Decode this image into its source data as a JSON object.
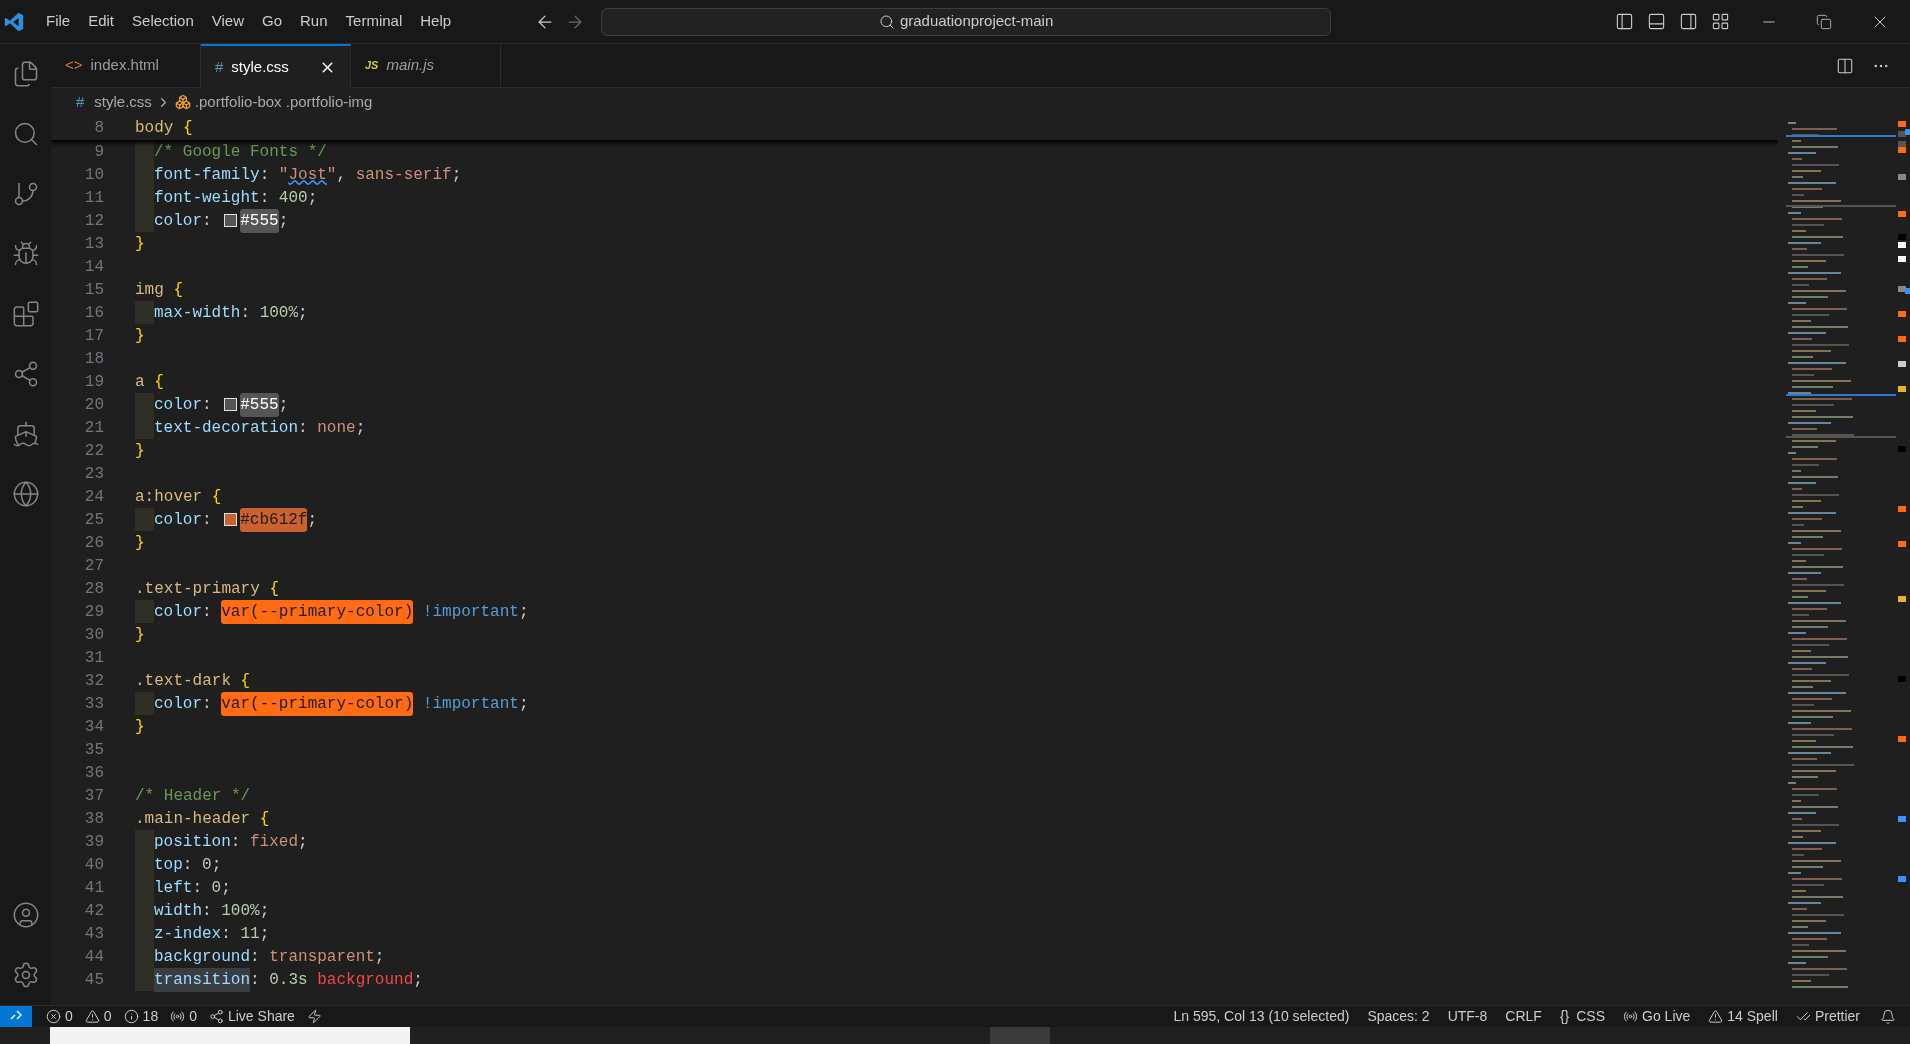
{
  "menu": [
    {
      "label": "File"
    },
    {
      "label": "Edit"
    },
    {
      "label": "Selection"
    },
    {
      "label": "View"
    },
    {
      "label": "Go"
    },
    {
      "label": "Run"
    },
    {
      "label": "Terminal"
    },
    {
      "label": "Help"
    }
  ],
  "command_center": {
    "text": "graduationproject-main"
  },
  "navigation": {
    "back_disabled": false,
    "forward_disabled": true
  },
  "tabs": [
    {
      "kind": "html",
      "icon_text": "<>",
      "label": "index.html",
      "selected": false,
      "preview": false
    },
    {
      "kind": "css",
      "icon_text": "#",
      "label": "style.css",
      "selected": true,
      "preview": false
    },
    {
      "kind": "js",
      "icon_text": "JS",
      "label": "main.js",
      "selected": false,
      "preview": true
    }
  ],
  "breadcrumb": {
    "icon_text": "#",
    "file": "style.css",
    "symbol": ".portfolio-box .portfolio-img"
  },
  "editor": {
    "sticky_line": {
      "number": "8",
      "tokens": [
        {
          "kind": "selector",
          "text": "body"
        },
        {
          "kind": "brace",
          "text": " {"
        }
      ]
    },
    "lines": [
      {
        "number": "9",
        "indented": true,
        "tokens": [
          {
            "kind": "comment",
            "text": "/* Google Fonts */"
          }
        ]
      },
      {
        "number": "10",
        "indented": true,
        "tokens": [
          {
            "kind": "property",
            "text": "font-family"
          },
          {
            "kind": "punct",
            "text": ": "
          },
          {
            "kind": "string",
            "text": "\""
          },
          {
            "kind": "misspelled",
            "text": "Jost"
          },
          {
            "kind": "string",
            "text": "\""
          },
          {
            "kind": "punct",
            "text": ", "
          },
          {
            "kind": "value",
            "text": "sans-serif"
          },
          {
            "kind": "punct",
            "text": ";"
          }
        ]
      },
      {
        "number": "11",
        "indented": true,
        "tokens": [
          {
            "kind": "property",
            "text": "font-weight"
          },
          {
            "kind": "punct",
            "text": ": "
          },
          {
            "kind": "number",
            "text": "400"
          },
          {
            "kind": "punct",
            "text": ";"
          }
        ]
      },
      {
        "number": "12",
        "indented": true,
        "tokens": [
          {
            "kind": "property",
            "text": "color"
          },
          {
            "kind": "punct",
            "text": ": "
          },
          {
            "kind": "color_literal",
            "text": "#555",
            "color": "#555555"
          },
          {
            "kind": "punct",
            "text": ";"
          }
        ]
      },
      {
        "number": "13",
        "indented": false,
        "tokens": [
          {
            "kind": "brace",
            "text": "}"
          }
        ]
      },
      {
        "number": "14",
        "indented": false
      },
      {
        "number": "15",
        "indented": false,
        "tokens": [
          {
            "kind": "selector",
            "text": "img"
          },
          {
            "kind": "brace",
            "text": " {"
          }
        ]
      },
      {
        "number": "16",
        "indented": true,
        "tokens": [
          {
            "kind": "property",
            "text": "max-width"
          },
          {
            "kind": "punct",
            "text": ": "
          },
          {
            "kind": "number",
            "text": "100%"
          },
          {
            "kind": "punct",
            "text": ";"
          }
        ]
      },
      {
        "number": "17",
        "indented": false,
        "tokens": [
          {
            "kind": "brace",
            "text": "}"
          }
        ]
      },
      {
        "number": "18",
        "indented": false
      },
      {
        "number": "19",
        "indented": false,
        "tokens": [
          {
            "kind": "selector",
            "text": "a"
          },
          {
            "kind": "brace",
            "text": " {"
          }
        ]
      },
      {
        "number": "20",
        "indented": true,
        "tokens": [
          {
            "kind": "property",
            "text": "color"
          },
          {
            "kind": "punct",
            "text": ": "
          },
          {
            "kind": "color_literal",
            "text": "#555",
            "color": "#555555"
          },
          {
            "kind": "punct",
            "text": ";"
          }
        ]
      },
      {
        "number": "21",
        "indented": true,
        "tokens": [
          {
            "kind": "property",
            "text": "text-decoration"
          },
          {
            "kind": "punct",
            "text": ": "
          },
          {
            "kind": "value",
            "text": "none"
          },
          {
            "kind": "punct",
            "text": ";"
          }
        ]
      },
      {
        "number": "22",
        "indented": false,
        "tokens": [
          {
            "kind": "brace",
            "text": "}"
          }
        ]
      },
      {
        "number": "23",
        "indented": false
      },
      {
        "number": "24",
        "indented": false,
        "tokens": [
          {
            "kind": "selector",
            "text": "a:hover"
          },
          {
            "kind": "brace",
            "text": " {"
          }
        ]
      },
      {
        "number": "25",
        "indented": true,
        "tokens": [
          {
            "kind": "property",
            "text": "color"
          },
          {
            "kind": "punct",
            "text": ": "
          },
          {
            "kind": "color_literal",
            "text": "#cb612f",
            "color": "#cb612f"
          },
          {
            "kind": "punct",
            "text": ";"
          }
        ]
      },
      {
        "number": "26",
        "indented": false,
        "tokens": [
          {
            "kind": "brace",
            "text": "}"
          }
        ]
      },
      {
        "number": "27",
        "indented": false
      },
      {
        "number": "28",
        "indented": false,
        "tokens": [
          {
            "kind": "selector",
            "text": ".text-primary"
          },
          {
            "kind": "brace",
            "text": " {"
          }
        ]
      },
      {
        "number": "29",
        "indented": true,
        "tokens": [
          {
            "kind": "property",
            "text": "color"
          },
          {
            "kind": "punct",
            "text": ": "
          },
          {
            "kind": "var_literal",
            "text": "var(--primary-color)",
            "color": "#ff6a13"
          },
          {
            "kind": "important",
            "text": " !important"
          },
          {
            "kind": "punct",
            "text": ";"
          }
        ]
      },
      {
        "number": "30",
        "indented": false,
        "tokens": [
          {
            "kind": "brace",
            "text": "}"
          }
        ]
      },
      {
        "number": "31",
        "indented": false
      },
      {
        "number": "32",
        "indented": false,
        "tokens": [
          {
            "kind": "selector",
            "text": ".text-dark"
          },
          {
            "kind": "brace",
            "text": " {"
          }
        ]
      },
      {
        "number": "33",
        "indented": true,
        "tokens": [
          {
            "kind": "property",
            "text": "color"
          },
          {
            "kind": "punct",
            "text": ": "
          },
          {
            "kind": "var_literal",
            "text": "var(--primary-color)",
            "color": "#ff6a13"
          },
          {
            "kind": "important",
            "text": " !important"
          },
          {
            "kind": "punct",
            "text": ";"
          }
        ]
      },
      {
        "number": "34",
        "indented": false,
        "tokens": [
          {
            "kind": "brace",
            "text": "}"
          }
        ]
      },
      {
        "number": "35",
        "indented": false
      },
      {
        "number": "36",
        "indented": false
      },
      {
        "number": "37",
        "indented": false,
        "tokens": [
          {
            "kind": "comment",
            "text": "/* Header */"
          }
        ]
      },
      {
        "number": "38",
        "indented": false,
        "tokens": [
          {
            "kind": "selector",
            "text": ".main-header"
          },
          {
            "kind": "brace",
            "text": " {"
          }
        ]
      },
      {
        "number": "39",
        "indented": true,
        "tokens": [
          {
            "kind": "property",
            "text": "position"
          },
          {
            "kind": "punct",
            "text": ": "
          },
          {
            "kind": "value",
            "text": "fixed"
          },
          {
            "kind": "punct",
            "text": ";"
          }
        ]
      },
      {
        "number": "40",
        "indented": true,
        "tokens": [
          {
            "kind": "property",
            "text": "top"
          },
          {
            "kind": "punct",
            "text": ": "
          },
          {
            "kind": "number",
            "text": "0"
          },
          {
            "kind": "punct",
            "text": ";"
          }
        ]
      },
      {
        "number": "41",
        "indented": true,
        "tokens": [
          {
            "kind": "property",
            "text": "left"
          },
          {
            "kind": "punct",
            "text": ": "
          },
          {
            "kind": "number",
            "text": "0"
          },
          {
            "kind": "punct",
            "text": ";"
          }
        ]
      },
      {
        "number": "42",
        "indented": true,
        "tokens": [
          {
            "kind": "property",
            "text": "width"
          },
          {
            "kind": "punct",
            "text": ": "
          },
          {
            "kind": "number",
            "text": "100%"
          },
          {
            "kind": "punct",
            "text": ";"
          }
        ]
      },
      {
        "number": "43",
        "indented": true,
        "tokens": [
          {
            "kind": "property",
            "text": "z-index"
          },
          {
            "kind": "punct",
            "text": ": "
          },
          {
            "kind": "number",
            "text": "11"
          },
          {
            "kind": "punct",
            "text": ";"
          }
        ]
      },
      {
        "number": "44",
        "indented": true,
        "tokens": [
          {
            "kind": "property",
            "text": "background"
          },
          {
            "kind": "punct",
            "text": ": "
          },
          {
            "kind": "value",
            "text": "transparent"
          },
          {
            "kind": "punct",
            "text": ";"
          }
        ]
      },
      {
        "number": "45",
        "indented": true,
        "tokens": [
          {
            "kind": "match",
            "text": "transition"
          },
          {
            "kind": "punct",
            "text": ": "
          },
          {
            "kind": "number",
            "text": "0.3s"
          },
          {
            "kind": "error",
            "text": " background"
          },
          {
            "kind": "punct",
            "text": ";"
          }
        ]
      }
    ]
  },
  "status_bar": {
    "left": [
      {
        "kind": "errors",
        "text": "0"
      },
      {
        "kind": "warnings",
        "text": "0"
      },
      {
        "kind": "info",
        "text": "18"
      },
      {
        "kind": "ports",
        "text": "0"
      },
      {
        "kind": "live_share",
        "text": "Live Share"
      }
    ],
    "right": [
      {
        "kind": "plain",
        "text": "Ln 595, Col 13 (10 selected)"
      },
      {
        "kind": "plain",
        "text": "Spaces: 2"
      },
      {
        "kind": "plain",
        "text": "UTF-8"
      },
      {
        "kind": "plain",
        "text": "CRLF"
      },
      {
        "kind": "language",
        "icon_text": "{}",
        "text": "CSS"
      },
      {
        "kind": "go_live",
        "text": "Go Live"
      },
      {
        "kind": "spell",
        "text": "14 Spell"
      },
      {
        "kind": "prettier",
        "text": "Prettier"
      }
    ]
  }
}
